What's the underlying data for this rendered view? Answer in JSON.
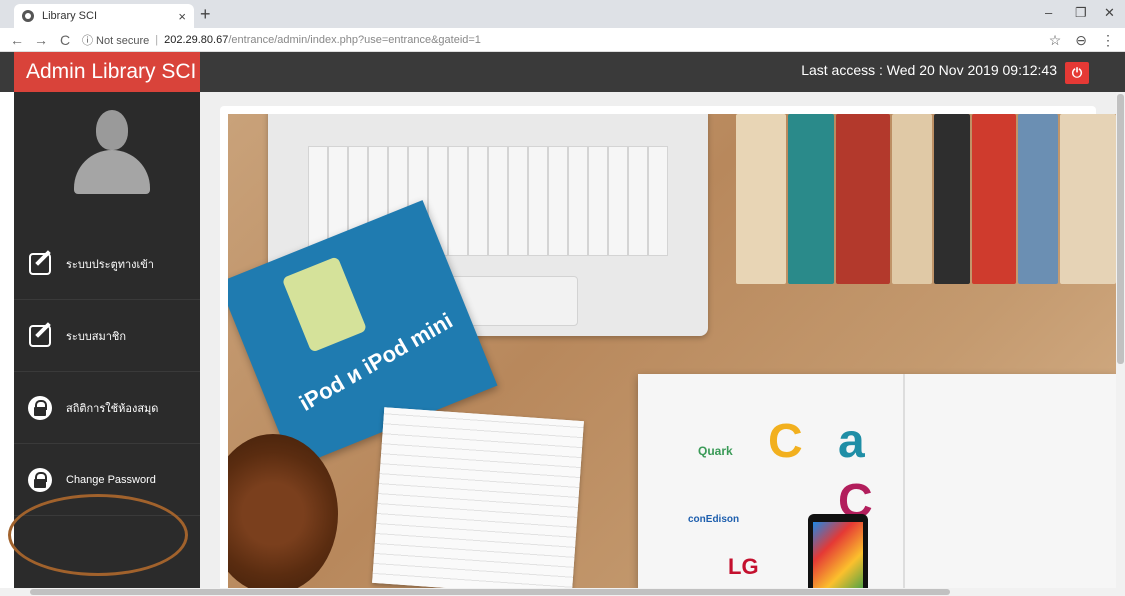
{
  "browser": {
    "tab_title": "Library SCI",
    "tab_close": "×",
    "new_tab": "+",
    "window_controls": [
      "–",
      "❐",
      "✕"
    ],
    "nav": {
      "back": "←",
      "forward": "→",
      "reload": "C"
    },
    "security_label": "ⓘ Not secure",
    "url_host": "202.29.80.67",
    "url_path": "/entrance/admin/index.php?use=entrance&gateid=1",
    "bookmark_icon": "☆",
    "profile_icon": "⊖",
    "menu_icon": "⋮"
  },
  "header": {
    "brand": "Admin Library SCI",
    "last_access": "Last access : Wed 20 Nov 2019 09:12:43",
    "power_icon": "⏻",
    "brand_color": "#d9433a",
    "power_color": "#e53935"
  },
  "sidebar": {
    "items": [
      {
        "label": "ระบบประตูทางเข้า",
        "icon": "edit-icon"
      },
      {
        "label": "ระบบสมาชิก",
        "icon": "edit-icon"
      },
      {
        "label": "สถิติการใช้ห้องสมุด",
        "icon": "lock-icon"
      },
      {
        "label": "Change Password",
        "icon": "lock-icon"
      }
    ]
  },
  "hero": {
    "ipod_text": "iPod и iPod mini",
    "logos": [
      "Quark",
      "conEdison",
      "LG"
    ]
  }
}
